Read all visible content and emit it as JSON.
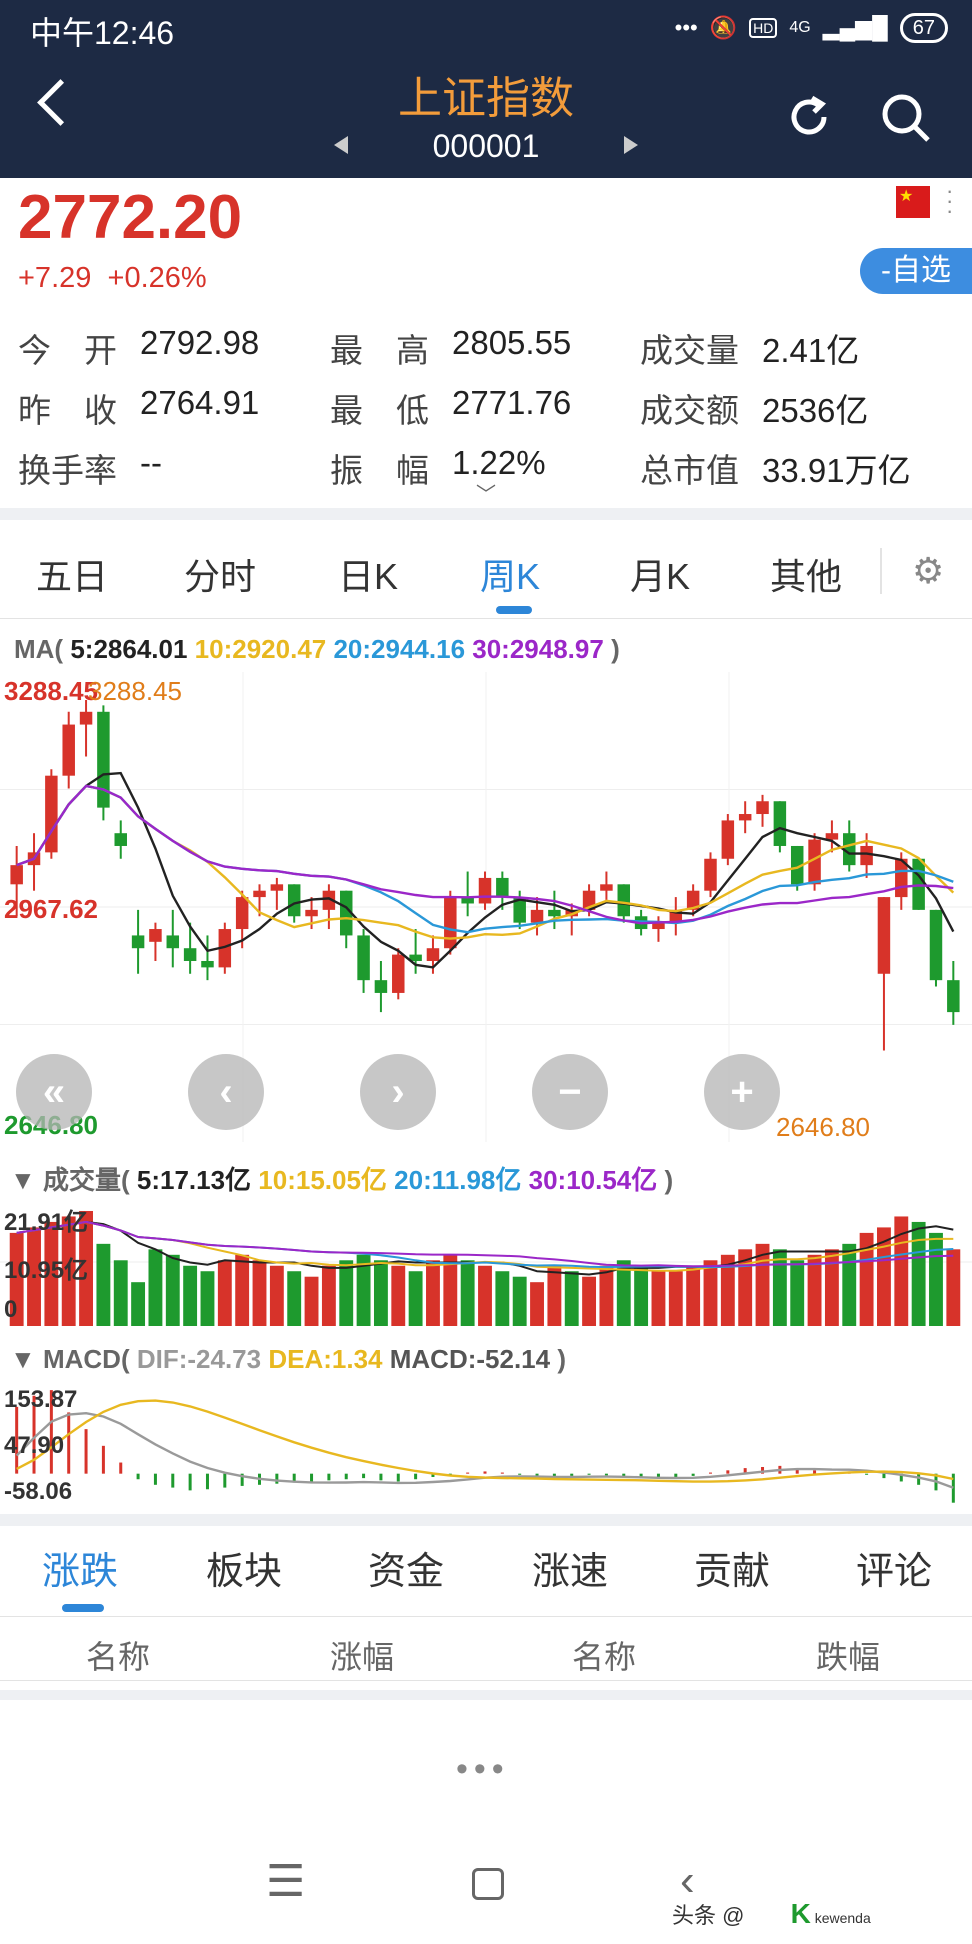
{
  "status_bar": {
    "time": "中午12:46",
    "network": "4G",
    "hd": "HD",
    "battery": "67"
  },
  "header": {
    "title": "上证指数",
    "code": "000001"
  },
  "quote": {
    "price": "2772.20",
    "change": "+7.29",
    "change_pct": "+0.26%",
    "fav_button": "-自选",
    "stats": [
      {
        "label": "今　开",
        "value": "2792.98"
      },
      {
        "label": "最　高",
        "value": "2805.55"
      },
      {
        "label": "成交量",
        "value": "2.41亿"
      },
      {
        "label": "昨　收",
        "value": "2764.91"
      },
      {
        "label": "最　低",
        "value": "2771.76"
      },
      {
        "label": "成交额",
        "value": "2536亿"
      },
      {
        "label": "换手率",
        "value": "--"
      },
      {
        "label": "振　幅",
        "value": "1.22%"
      },
      {
        "label": "总市值",
        "value": "33.91万亿"
      }
    ]
  },
  "chart_tabs": [
    "五日",
    "分时",
    "日K",
    "周K",
    "月K",
    "其他"
  ],
  "active_chart_tab": "周K",
  "ma": {
    "prefix": "MA(",
    "ma5": "5:2864.01",
    "ma10": "10:2920.47",
    "ma20": "20:2944.16",
    "ma30": "30:2948.97",
    "suffix": ")"
  },
  "kline_labels": {
    "high_left": "3288.45",
    "high_right": "3288.45",
    "mid": "2967.62",
    "low_left": "2646.80",
    "low_right": "2646.80"
  },
  "volume": {
    "prefix": "▼ 成交量(",
    "v5": "5:17.13亿",
    "v10": "10:15.05亿",
    "v20": "20:11.98亿",
    "v30": "30:10.54亿",
    "suffix": ")",
    "axis": [
      "21.91亿",
      "10.95亿",
      "0"
    ]
  },
  "macd": {
    "prefix": "▼ MACD(",
    "dif": "DIF:-24.73",
    "dea": "DEA:1.34",
    "macd": "MACD:-52.14",
    "suffix": ")",
    "axis": [
      "153.87",
      "47.90",
      "-58.06"
    ]
  },
  "bottom_tabs": [
    "涨跌",
    "板块",
    "资金",
    "涨速",
    "贡献",
    "评论"
  ],
  "active_bottom_tab": "涨跌",
  "table_headers": [
    "名称",
    "涨幅",
    "名称",
    "跌幅"
  ],
  "watermark": "头条 @",
  "colors": {
    "up": "#d7332a",
    "down": "#1e9a2e",
    "ma5": "#222222",
    "ma10": "#e8b820",
    "ma20": "#2a98d8",
    "ma30": "#9b27c8",
    "accent": "#2d86d8",
    "header_bg": "#1d2a44"
  },
  "chart_data": [
    {
      "type": "candlestick",
      "title": "上证指数 周K",
      "ylim": [
        2646.8,
        3288.45
      ],
      "ohlc": [
        [
          3000,
          3060,
          2950,
          3030
        ],
        [
          3030,
          3080,
          2990,
          3050
        ],
        [
          3050,
          3180,
          3040,
          3170
        ],
        [
          3170,
          3270,
          3150,
          3250
        ],
        [
          3250,
          3288.45,
          3200,
          3270
        ],
        [
          3270,
          3280,
          3100,
          3120
        ],
        [
          3080,
          3100,
          3040,
          3060
        ],
        [
          2920,
          2960,
          2860,
          2900
        ],
        [
          2910,
          2940,
          2880,
          2930
        ],
        [
          2920,
          2960,
          2870,
          2900
        ],
        [
          2900,
          2940,
          2860,
          2880
        ],
        [
          2880,
          2920,
          2850,
          2870
        ],
        [
          2870,
          2940,
          2860,
          2930
        ],
        [
          2930,
          2990,
          2900,
          2980
        ],
        [
          2980,
          3000,
          2950,
          2990
        ],
        [
          2990,
          3010,
          2960,
          3000
        ],
        [
          3000,
          3000,
          2940,
          2950
        ],
        [
          2950,
          2980,
          2930,
          2960
        ],
        [
          2960,
          3000,
          2930,
          2990
        ],
        [
          2990,
          2990,
          2900,
          2920
        ],
        [
          2920,
          2930,
          2830,
          2850
        ],
        [
          2850,
          2880,
          2800,
          2830
        ],
        [
          2830,
          2900,
          2820,
          2890
        ],
        [
          2890,
          2930,
          2860,
          2880
        ],
        [
          2880,
          2920,
          2860,
          2900
        ],
        [
          2900,
          2990,
          2890,
          2980
        ],
        [
          2980,
          3020,
          2950,
          2970
        ],
        [
          2970,
          3020,
          2960,
          3010
        ],
        [
          3010,
          3020,
          2960,
          2980
        ],
        [
          2980,
          2990,
          2930,
          2940
        ],
        [
          2940,
          2980,
          2920,
          2960
        ],
        [
          2960,
          2990,
          2930,
          2950
        ],
        [
          2950,
          2970,
          2920,
          2960
        ],
        [
          2960,
          3000,
          2950,
          2990
        ],
        [
          2990,
          3020,
          2970,
          3000
        ],
        [
          3000,
          3000,
          2940,
          2950
        ],
        [
          2950,
          2960,
          2920,
          2930
        ],
        [
          2930,
          2950,
          2910,
          2940
        ],
        [
          2940,
          2980,
          2920,
          2960
        ],
        [
          2960,
          3000,
          2950,
          2990
        ],
        [
          2990,
          3050,
          2980,
          3040
        ],
        [
          3040,
          3110,
          3030,
          3100
        ],
        [
          3100,
          3130,
          3080,
          3110
        ],
        [
          3110,
          3140,
          3090,
          3130
        ],
        [
          3130,
          3130,
          3050,
          3060
        ],
        [
          3060,
          3060,
          2990,
          3000
        ],
        [
          3000,
          3080,
          2990,
          3070
        ],
        [
          3070,
          3100,
          3050,
          3080
        ],
        [
          3080,
          3100,
          3020,
          3030
        ],
        [
          3030,
          3080,
          3010,
          3060
        ],
        [
          2860,
          2980,
          2740,
          2980
        ],
        [
          2980,
          3050,
          2960,
          3040
        ],
        [
          3040,
          3040,
          2960,
          2960
        ],
        [
          2960,
          2960,
          2840,
          2850
        ],
        [
          2850,
          2880,
          2780,
          2800
        ]
      ],
      "ma_series": [
        "MA5",
        "MA10",
        "MA20",
        "MA30"
      ]
    },
    {
      "type": "bar",
      "title": "成交量",
      "ylabel": "亿",
      "ylim": [
        0,
        21.91
      ],
      "values": [
        17,
        18,
        19,
        20,
        21,
        15,
        12,
        8,
        14,
        13,
        11,
        10,
        12,
        13,
        12,
        11,
        10,
        9,
        11,
        12,
        13,
        12,
        11,
        10,
        12,
        13,
        12,
        11,
        10,
        9,
        8,
        11,
        10,
        9,
        11,
        12,
        11,
        10,
        10,
        11,
        12,
        13,
        14,
        15,
        14,
        12,
        13,
        14,
        15,
        17,
        18,
        20,
        19,
        17,
        14
      ],
      "up_flags": [
        1,
        1,
        1,
        1,
        1,
        0,
        0,
        0,
        0,
        0,
        0,
        0,
        1,
        1,
        1,
        1,
        0,
        1,
        1,
        0,
        0,
        0,
        1,
        0,
        1,
        1,
        0,
        1,
        0,
        0,
        1,
        1,
        0,
        1,
        1,
        0,
        0,
        1,
        1,
        1,
        1,
        1,
        1,
        1,
        0,
        0,
        1,
        1,
        0,
        1,
        1,
        1,
        0,
        0,
        1
      ]
    },
    {
      "type": "bar",
      "title": "MACD",
      "ylim": [
        -58.06,
        153.87
      ],
      "values": [
        120,
        140,
        150,
        110,
        80,
        50,
        20,
        -10,
        -20,
        -25,
        -30,
        -28,
        -25,
        -22,
        -20,
        -18,
        -16,
        -14,
        -12,
        -10,
        -8,
        -12,
        -14,
        -10,
        -6,
        -3,
        2,
        4,
        2,
        -2,
        -4,
        -6,
        -4,
        -2,
        -3,
        -5,
        -7,
        -8,
        -6,
        -4,
        2,
        6,
        10,
        12,
        14,
        10,
        6,
        2,
        4,
        -2,
        -8,
        -14,
        -20,
        -30,
        -52.14
      ]
    }
  ]
}
